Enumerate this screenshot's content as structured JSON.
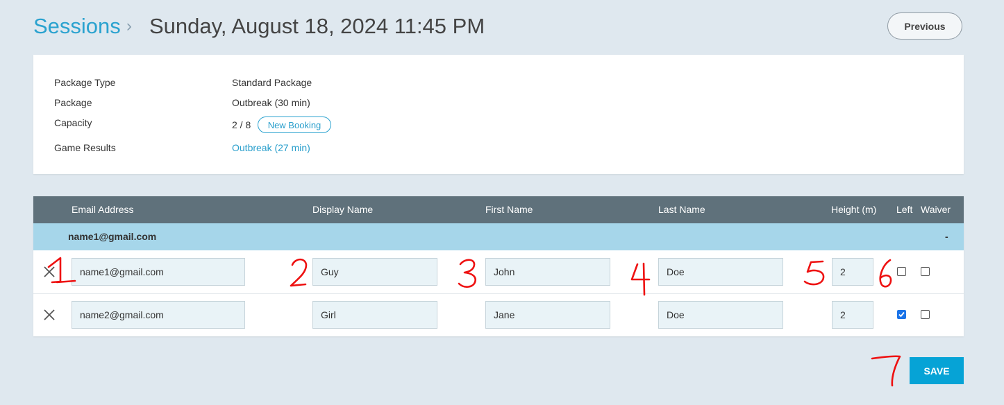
{
  "header": {
    "breadcrumb_link": "Sessions",
    "breadcrumb_separator": "›",
    "title": "Sunday, August 18, 2024 11:45 PM",
    "previous_label": "Previous"
  },
  "info": {
    "package_type_label": "Package Type",
    "package_type_value": "Standard Package",
    "package_label": "Package",
    "package_value": "Outbreak (30 min)",
    "capacity_label": "Capacity",
    "capacity_value": "2 / 8",
    "new_booking_label": "New Booking",
    "game_results_label": "Game Results",
    "game_results_value": "Outbreak (27 min)"
  },
  "table": {
    "headers": {
      "email": "Email Address",
      "display": "Display Name",
      "first": "First Name",
      "last": "Last Name",
      "height": "Height (m)",
      "left": "Left",
      "waiver": "Waiver"
    },
    "group": {
      "email": "name1@gmail.com",
      "toggle": "-"
    },
    "rows": [
      {
        "email": "name1@gmail.com",
        "display": "Guy",
        "first": "John",
        "last": "Doe",
        "height": "2",
        "left": false,
        "waiver": false
      },
      {
        "email": "name2@gmail.com",
        "display": "Girl",
        "first": "Jane",
        "last": "Doe",
        "height": "2",
        "left": true,
        "waiver": false
      }
    ]
  },
  "save_label": "SAVE",
  "annotations": [
    "1",
    "2",
    "3",
    "4",
    "5",
    "6",
    "7"
  ],
  "colors": {
    "background": "#dfe8ef",
    "accent": "#2aa2cf",
    "table_header": "#5f717b",
    "group_row": "#a6d6ea",
    "save_button": "#06a3d6",
    "annotation": "#ee1111"
  }
}
